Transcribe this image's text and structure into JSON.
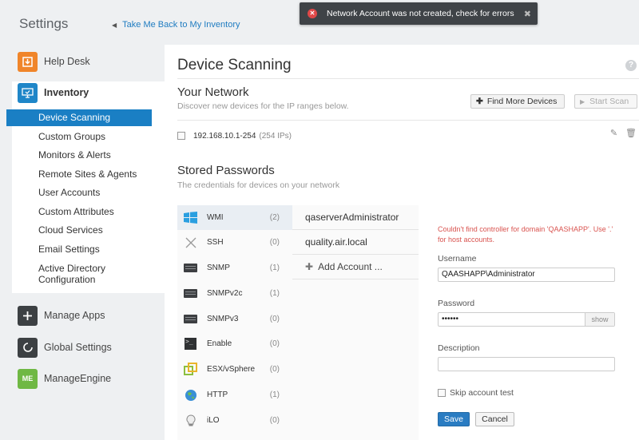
{
  "app": {
    "title": "Settings",
    "back_link": "Take Me Back to My Inventory"
  },
  "sidebar": {
    "help_desk": "Help Desk",
    "inventory": "Inventory",
    "inventory_items": [
      "Device Scanning",
      "Custom Groups",
      "Monitors & Alerts",
      "Remote Sites & Agents",
      "User Accounts",
      "Custom Attributes",
      "Cloud Services",
      "Email Settings",
      "Active Directory Configuration"
    ],
    "active_item": "Device Scanning",
    "manage_apps": "Manage Apps",
    "global_settings": "Global Settings",
    "manage_engine": "ManageEngine",
    "manage_engine_icon_text": "ME",
    "colors": {
      "help_desk": "#f0852a",
      "inventory": "#1f86c8",
      "manage_apps": "#3c4043",
      "global_settings": "#3c4043",
      "manage_engine": "#6fb844",
      "active": "#1a7fc4"
    }
  },
  "toast": {
    "message": "Network Account was not created, check for errors",
    "icon": "error-icon",
    "close": "✖"
  },
  "main": {
    "title": "Device Scanning",
    "help": "?",
    "network": {
      "title": "Your Network",
      "subtitle": "Discover new devices for the IP ranges below.",
      "find_more_label": "Find More Devices",
      "start_scan_label": "Start Scan",
      "range": "192.168.10.1-254",
      "range_count": "(254 IPs)"
    },
    "passwords": {
      "title": "Stored Passwords",
      "subtitle": "The credentials for devices on your network",
      "types": [
        {
          "name": "WMI",
          "count": "(2)",
          "icon": "windows-icon"
        },
        {
          "name": "SSH",
          "count": "(0)",
          "icon": "ssh-x-icon"
        },
        {
          "name": "SNMP",
          "count": "(1)",
          "icon": "device-icon"
        },
        {
          "name": "SNMPv2c",
          "count": "(1)",
          "icon": "device-icon"
        },
        {
          "name": "SNMPv3",
          "count": "(0)",
          "icon": "device-icon"
        },
        {
          "name": "Enable",
          "count": "(0)",
          "icon": "terminal-icon"
        },
        {
          "name": "ESX/vSphere",
          "count": "(0)",
          "icon": "vsphere-icon"
        },
        {
          "name": "HTTP",
          "count": "(1)",
          "icon": "globe-icon"
        },
        {
          "name": "iLO",
          "count": "(0)",
          "icon": "bulb-icon"
        }
      ],
      "accounts": [
        "qaserverAdministrator",
        "quality.air.local",
        "Add Account ..."
      ],
      "form": {
        "error": "Couldn't find controller for domain 'QAASHAPP'. Use '.' for host accounts.",
        "username_label": "Username",
        "username_value": "QAASHAPP\\Administrator",
        "password_label": "Password",
        "password_value": "••••••",
        "show_label": "show",
        "description_label": "Description",
        "description_value": "",
        "skip_label": "Skip account test",
        "save_label": "Save",
        "cancel_label": "Cancel"
      }
    }
  }
}
